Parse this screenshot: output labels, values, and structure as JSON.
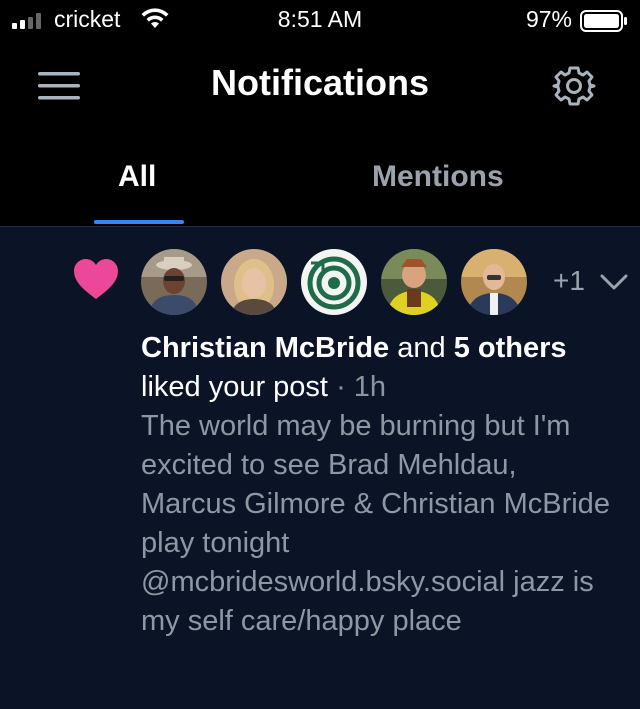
{
  "status": {
    "carrier": "cricket",
    "time": "8:51 AM",
    "battery": "97%"
  },
  "header": {
    "title": "Notifications"
  },
  "tabs": [
    {
      "label": "All",
      "active": true
    },
    {
      "label": "Mentions",
      "active": false
    }
  ],
  "notification": {
    "type_icon": "heart-icon",
    "extra_count": "+1",
    "actor": "Christian McBride",
    "connector": "and",
    "others": "5 others",
    "action": "liked your post",
    "separator": "·",
    "time": "1h",
    "post_text": "The world may be burning but I'm excited to see Brad Mehldau, Marcus Gilmore & Christian McBride play tonight @mcbridesworld.bsky.social jazz is my self care/happy place"
  },
  "colors": {
    "accent": "#3b82f6",
    "heart": "#ec4899",
    "feed_bg": "#0a1426",
    "muted": "#8e98a4"
  }
}
